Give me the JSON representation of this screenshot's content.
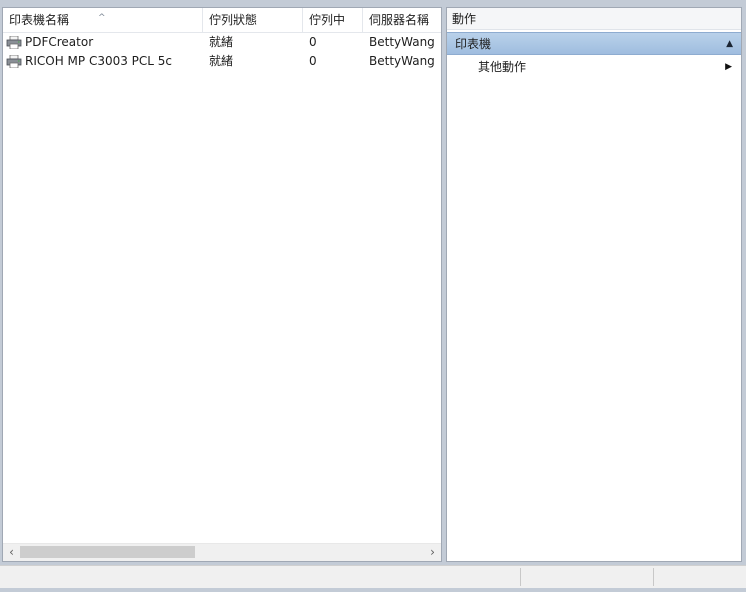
{
  "printers_pane": {
    "columns": [
      "印表機名稱",
      "佇列狀態",
      "佇列中",
      "伺服器名稱"
    ],
    "rows": [
      {
        "name": "PDFCreator",
        "status": "就緒",
        "queue": "0",
        "server": "BettyWang ("
      },
      {
        "name": "RICOH MP C3003 PCL 5c",
        "status": "就緒",
        "queue": "0",
        "server": "BettyWang ("
      }
    ],
    "icon": "printer-icon"
  },
  "actions_pane": {
    "title": "動作",
    "section_label": "印表機",
    "items": [
      {
        "label": "其他動作"
      }
    ]
  },
  "colors": {
    "section_bg": "#aac6e6",
    "frame": "#c3cbd6",
    "scroll_thumb": "#cdcdcd"
  }
}
